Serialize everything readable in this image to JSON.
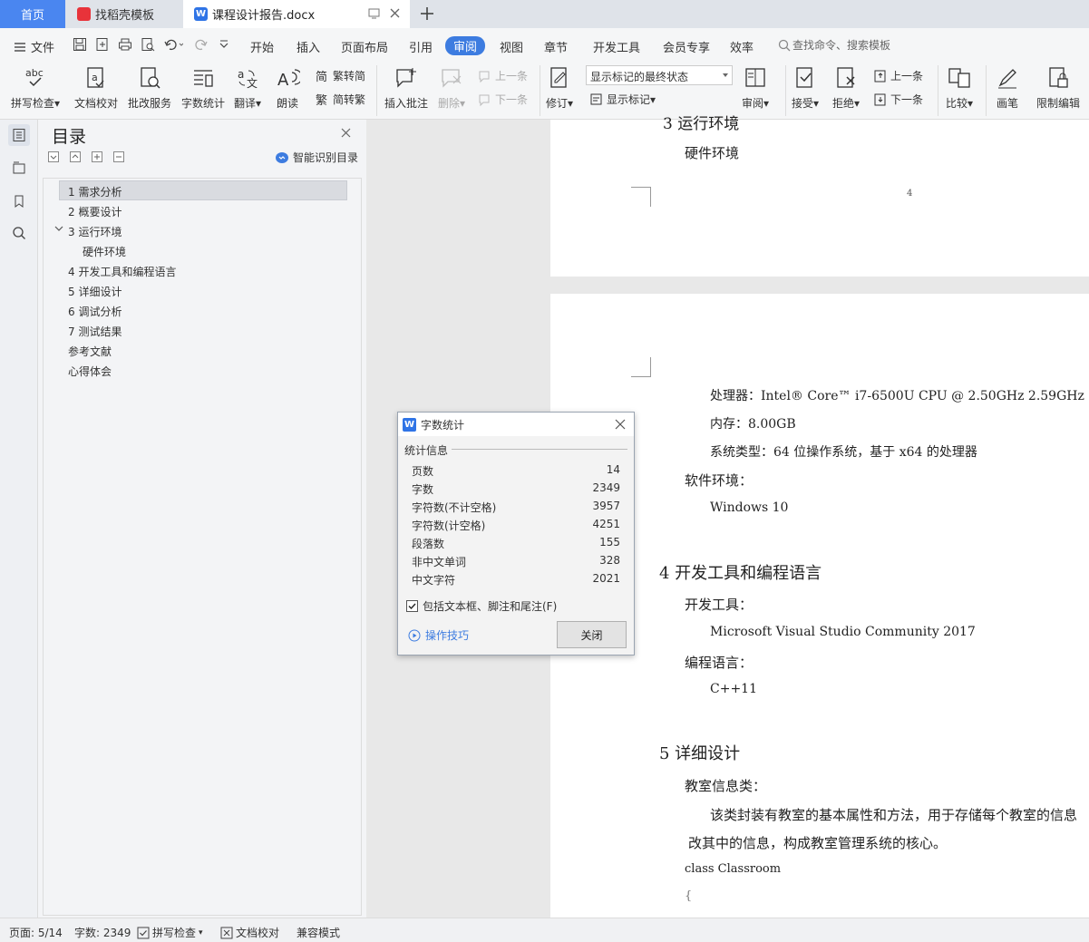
{
  "tabs": {
    "home": "首页",
    "template": "找稻壳模板",
    "document": "课程设计报告.docx"
  },
  "menu": {
    "file": "文件",
    "items": [
      "开始",
      "插入",
      "页面布局",
      "引用",
      "审阅",
      "视图",
      "章节",
      "开发工具",
      "会员专享",
      "效率"
    ],
    "search": "查找命令、搜索模板"
  },
  "ribbon": {
    "spellcheck": "拼写检查",
    "doc_proof": "文档校对",
    "correction": "批改服务",
    "word_count": "字数统计",
    "translate": "翻译",
    "read_aloud": "朗读",
    "trad_to_simp": "繁转简",
    "simp_to_trad": "简转繁",
    "insert_comment": "插入批注",
    "delete": "删除",
    "prev": "上一条",
    "next": "下一条",
    "revise": "修订",
    "markup_state": "显示标记的最终状态",
    "show_markup": "显示标记",
    "review": "审阅",
    "accept": "接受",
    "reject": "拒绝",
    "prev2": "上一条",
    "next2": "下一条",
    "compare": "比较",
    "pen": "画笔",
    "restrict": "限制编辑"
  },
  "toc": {
    "title": "目录",
    "smart": "智能识别目录",
    "items": [
      "1 需求分析",
      "2 概要设计",
      "3 运行环境",
      "硬件环境",
      "4 开发工具和编程语言",
      "5 详细设计",
      "6 调试分析",
      "7 测试结果",
      "参考文献",
      "心得体会"
    ]
  },
  "doc": {
    "p1_heading": "3  运行环境",
    "p1_hw": "硬件环境",
    "p1_pagenum": "4",
    "cpu": "处理器：Intel® Core™ i7-6500U CPU @ 2.50GHz 2.59GHz",
    "mem": "内存：8.00GB",
    "systype": "系统类型：64 位操作系统，基于 x64 的处理器",
    "sw": "软件环境：",
    "win": "Windows 10",
    "h4": "4  开发工具和编程语言",
    "devtool": "开发工具：",
    "vs": "Microsoft Visual Studio Community 2017",
    "lang": "编程语言：",
    "cpp": "C++11",
    "h5": "5  详细设计",
    "classroom": "教室信息类：",
    "desc1": "该类封装有教室的基本属性和方法，用于存储每个教室的信息",
    "desc2": "改其中的信息，构成教室管理系统的核心。",
    "code1": "class Classroom",
    "code2": "{"
  },
  "dialog": {
    "title": "字数统计",
    "section": "统计信息",
    "stats": [
      {
        "label": "页数",
        "value": "14"
      },
      {
        "label": "字数",
        "value": "2349"
      },
      {
        "label": "字符数(不计空格)",
        "value": "3957"
      },
      {
        "label": "字符数(计空格)",
        "value": "4251"
      },
      {
        "label": "段落数",
        "value": "155"
      },
      {
        "label": "非中文单词",
        "value": "328"
      },
      {
        "label": "中文字符",
        "value": "2021"
      }
    ],
    "include": "包括文本框、脚注和尾注(F)",
    "tips": "操作技巧",
    "close": "关闭"
  },
  "status": {
    "page": "页面: 5/14",
    "words": "字数: 2349",
    "spell": "拼写检查",
    "proof": "文档校对",
    "compat": "兼容模式"
  },
  "colors": {
    "accent": "#3d7ce0",
    "home_tab": "#4a86f0",
    "template_icon": "#e8333a"
  }
}
